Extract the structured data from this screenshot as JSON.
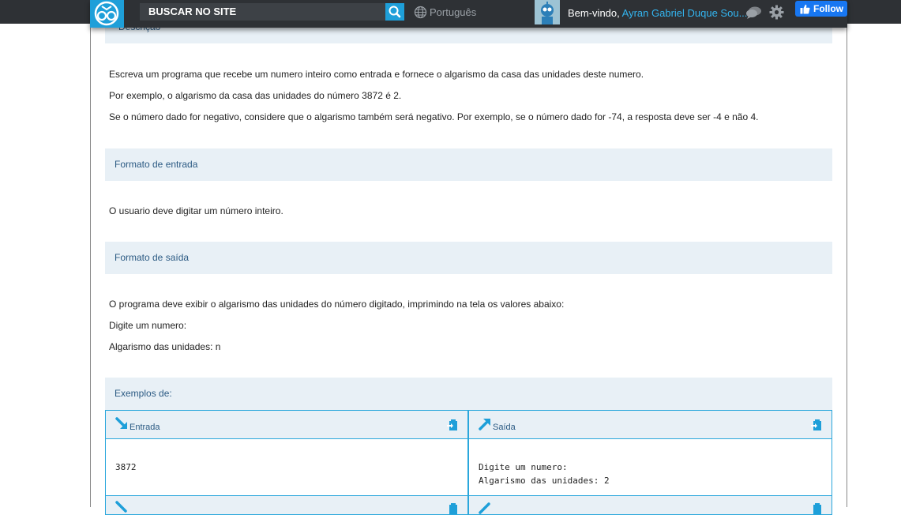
{
  "topbar": {
    "search_label": "BUSCAR NO SITE",
    "language": "Português",
    "welcome_prefix": "Bem-vindo,",
    "user_name": "Ayran Gabriel Duque Sou...",
    "follow_label": "Follow"
  },
  "sections": {
    "description_header": "Descrição",
    "description": [
      "Escreva um programa que recebe um numero inteiro como entrada e fornece o algarismo da casa das unidades deste numero.",
      "Por exemplo, o algarismo da casa das unidades do número 3872 é 2.",
      "Se o número dado for negativo, considere que o algarismo também será negativo. Por exemplo, se o número dado for -74, a resposta deve ser -4 e não 4."
    ],
    "input_header": "Formato de entrada",
    "input_text": "O usuario deve digitar um número inteiro.",
    "output_header": "Formato de saída",
    "output_lines": [
      "O programa deve exibir o algarismo das unidades do número digitado, imprimindo na tela os valores abaixo:",
      "Digite um numero:",
      "Algarismo das unidades: n"
    ],
    "examples_header": "Exemplos de:"
  },
  "examples": {
    "input_label": "Entrada",
    "output_label": "Saída",
    "rows": [
      {
        "input": "3872",
        "output_line1": "Digite um numero:",
        "output_line2": "Algarismo das unidades: 2"
      }
    ]
  },
  "colors": {
    "accent": "#1e9fd9",
    "topbar": "#2e3135",
    "section_bg": "#e8f0f6",
    "section_text": "#2b5a83"
  }
}
